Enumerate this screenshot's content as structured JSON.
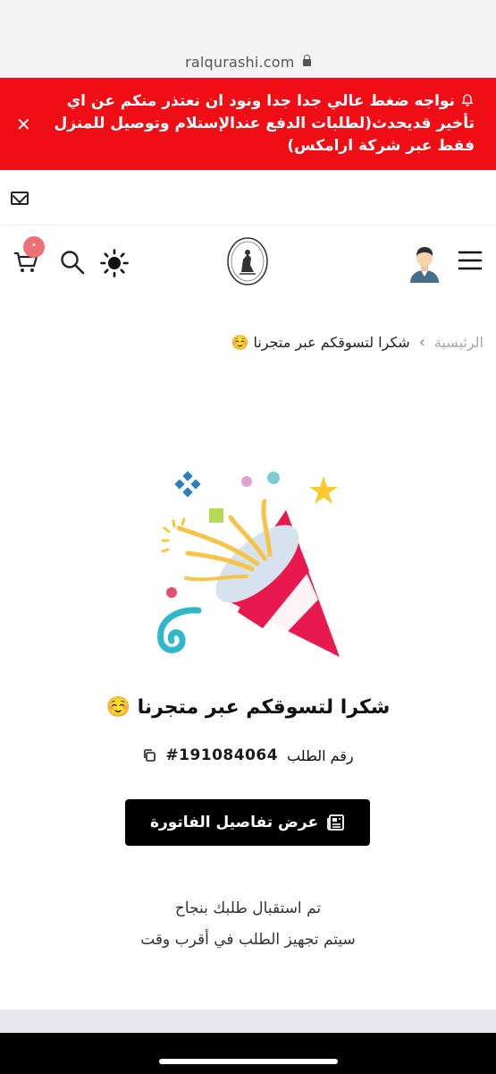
{
  "browser": {
    "url": "ralqurashi.com"
  },
  "banner": {
    "text": "نواجه ضغط عالي جدا جدا ونود ان نعتذر منكم عن اي تأخير قديحدث(لطلبات الدفع عندالإستلام وتوصيل للمنزل فقط عبر شركة ارامكس)",
    "close": "✕",
    "color": "#ef0e15"
  },
  "header": {
    "cart_badge": "•",
    "icons": [
      "mail-icon",
      "cart-icon",
      "search-icon",
      "sun-icon",
      "logo",
      "avatar",
      "menu-icon"
    ]
  },
  "breadcrumb": {
    "home": "الرئيسية",
    "separator": "›",
    "current": "شكرا لتسوقكم عبر متجرنا ☺️"
  },
  "main": {
    "title": "شكرا لتسوقكم عبر متجرنا ☺️",
    "order_label": "رقم الطلب",
    "order_number": "#191084064",
    "invoice_button": "عرض تفاصيل الفاتورة",
    "message_line1": "تم استقبال طلبك بنجاح",
    "message_line2": "سيتم تجهيز الطلب في أقرب وقت"
  }
}
